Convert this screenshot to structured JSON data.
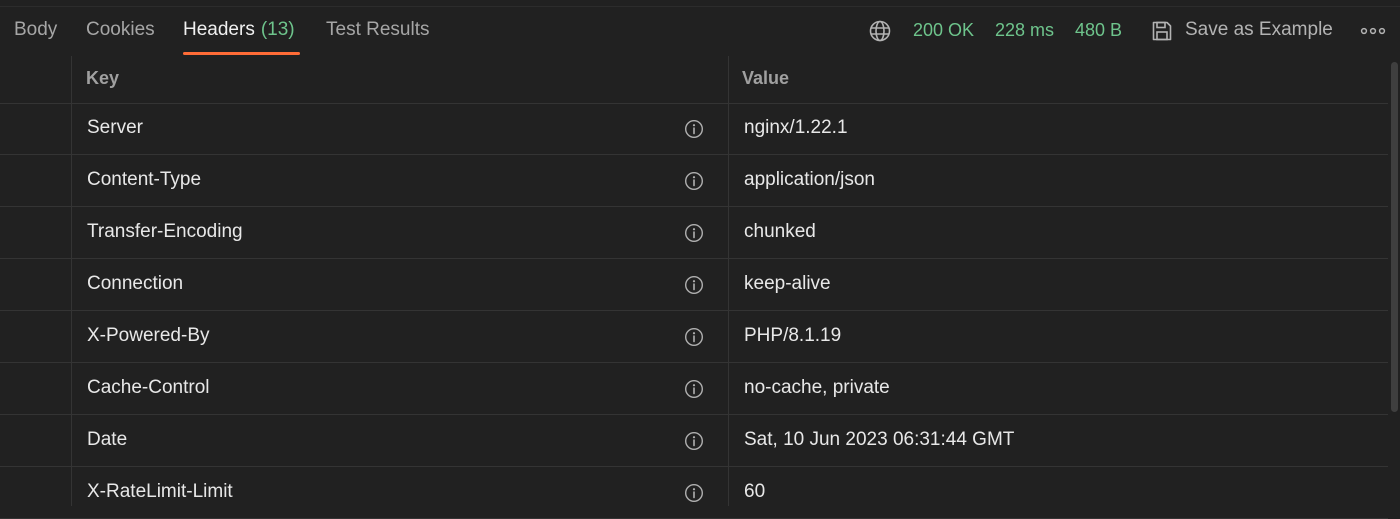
{
  "tabs": [
    {
      "label": "Body"
    },
    {
      "label": "Cookies"
    },
    {
      "label": "Headers",
      "count": "(13)"
    },
    {
      "label": "Test Results"
    }
  ],
  "status": {
    "code": "200 OK",
    "time": "228 ms",
    "size": "480 B",
    "save_label": "Save as Example"
  },
  "table": {
    "columns": [
      "Key",
      "Value"
    ],
    "rows": [
      {
        "key": "Server",
        "value": "nginx/1.22.1"
      },
      {
        "key": "Content-Type",
        "value": "application/json"
      },
      {
        "key": "Transfer-Encoding",
        "value": "chunked"
      },
      {
        "key": "Connection",
        "value": "keep-alive"
      },
      {
        "key": "X-Powered-By",
        "value": "PHP/8.1.19"
      },
      {
        "key": "Cache-Control",
        "value": "no-cache, private"
      },
      {
        "key": "Date",
        "value": "Sat, 10 Jun 2023 06:31:44 GMT"
      },
      {
        "key": "X-RateLimit-Limit",
        "value": "60"
      }
    ]
  },
  "icons": {
    "network": "globe-icon",
    "save": "save-icon",
    "more": "more-horizontal-icon",
    "info": "info-icon"
  },
  "colors": {
    "accent": "#ff6c37",
    "success": "#6ec48c",
    "background": "#212121"
  }
}
